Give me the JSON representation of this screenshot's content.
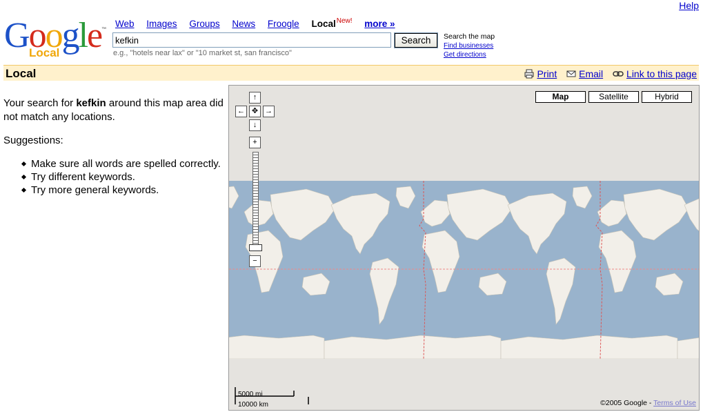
{
  "header": {
    "help": "Help",
    "logo": {
      "word": "Google",
      "sub": "Local",
      "tm": "™"
    },
    "tabs": [
      {
        "label": "Web"
      },
      {
        "label": "Images"
      },
      {
        "label": "Groups"
      },
      {
        "label": "News"
      },
      {
        "label": "Froogle"
      },
      {
        "label": "Local",
        "badge": "New!"
      },
      {
        "label": "more »"
      }
    ],
    "search": {
      "value": "kefkin",
      "button": "Search",
      "hint": "e.g., \"hotels near lax\" or \"10 market st, san francisco\""
    },
    "side_links": {
      "search_map": "Search the map",
      "find_businesses": "Find businesses",
      "get_directions": "Get directions"
    }
  },
  "localbar": {
    "title": "Local",
    "print": "Print",
    "email": "Email",
    "link": "Link to this page"
  },
  "results": {
    "prefix": "Your search for ",
    "query": "kefkin",
    "suffix": " around this map area did not match any locations.",
    "suggestions_label": "Suggestions:",
    "suggestions": [
      "Make sure all words are spelled correctly.",
      "Try different keywords.",
      "Try more general keywords."
    ]
  },
  "map": {
    "types": [
      "Map",
      "Satellite",
      "Hybrid"
    ],
    "active_type": "Map",
    "icons": {
      "pan_up": "arrow-up-icon",
      "pan_left": "arrow-left-icon",
      "pan_center": "center-icon",
      "pan_right": "arrow-right-icon",
      "pan_down": "arrow-down-icon",
      "zoom_in": "plus-icon",
      "zoom_out": "minus-icon"
    },
    "scale_mi": "5000 mi",
    "scale_km": "10000 km",
    "copyright": "©2005 Google - ",
    "terms": "Terms of Use",
    "colors": {
      "ocean": "#99b3cc",
      "land": "#f2efe9",
      "background": "#e5e3df"
    }
  },
  "colors": {
    "localbar_bg": "#fff1cc",
    "link": "#0000cc"
  }
}
